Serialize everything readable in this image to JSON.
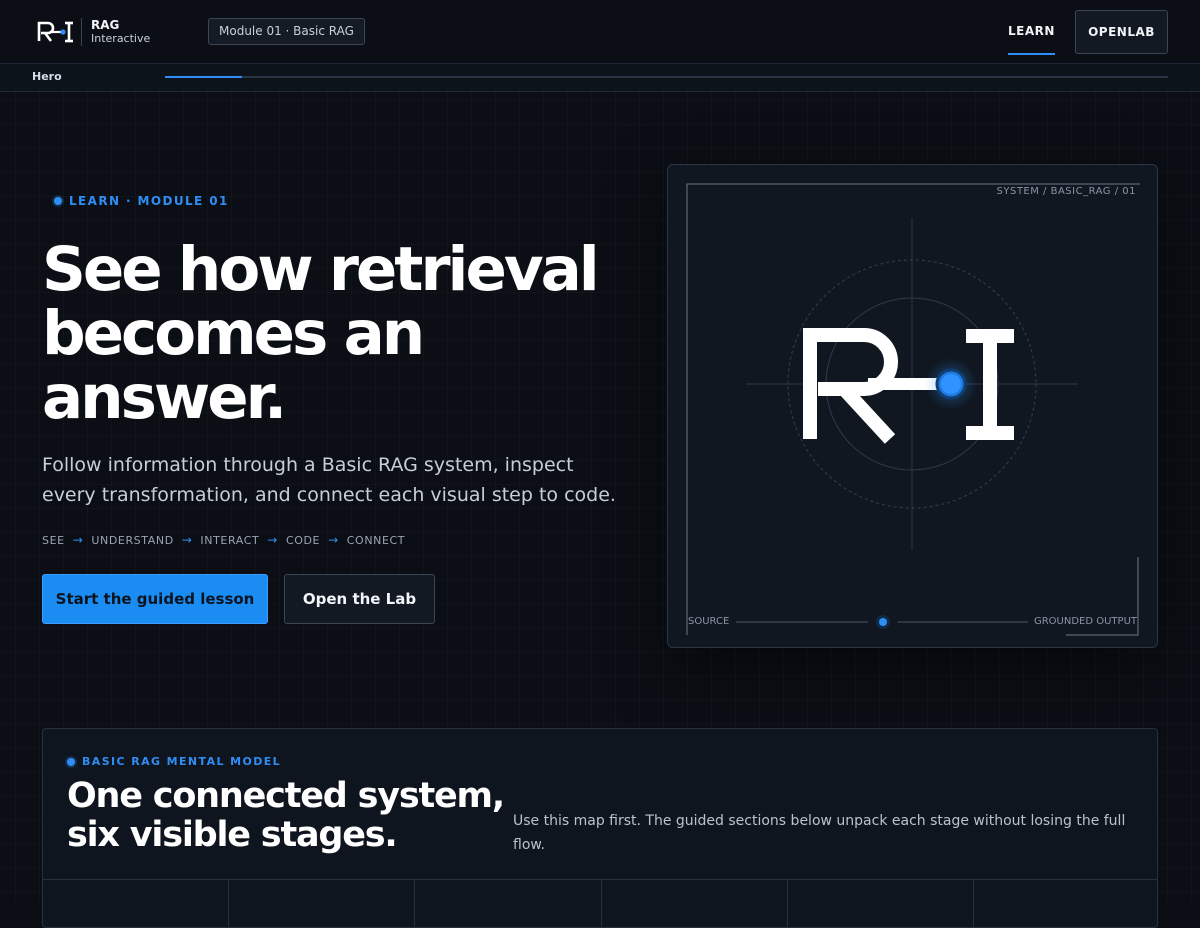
{
  "brand": {
    "name": "RAG",
    "subtitle": "Interactive"
  },
  "header": {
    "module_chip": "Module 01 · Basic RAG",
    "nav_learn": "LEARN",
    "nav_openlab": "OPENLAB"
  },
  "progress": {
    "section": "Hero",
    "fill_fraction": 0.077
  },
  "hero": {
    "eyebrow": "LEARN · MODULE 01",
    "title": "See how retrieval becomes an answer.",
    "description": "Follow information through a Basic RAG system, inspect every transformation, and connect each visual step to code.",
    "steps": [
      "SEE",
      "UNDERSTAND",
      "INTERACT",
      "CODE",
      "CONNECT"
    ],
    "primary_button": "Start the guided lesson",
    "secondary_button": "Open the Lab"
  },
  "diagram": {
    "code": "SYSTEM / BASIC_RAG / 01",
    "source_label": "SOURCE",
    "output_label": "GROUNDED OUTPUT"
  },
  "model": {
    "eyebrow": "BASIC RAG MENTAL MODEL",
    "title": "One connected system, six visible stages.",
    "description": "Use this map first. The guided sections below unpack each stage without losing the full flow."
  },
  "colors": {
    "accent": "#2f8ef5",
    "background": "#0b0f15",
    "card": "#101720"
  }
}
